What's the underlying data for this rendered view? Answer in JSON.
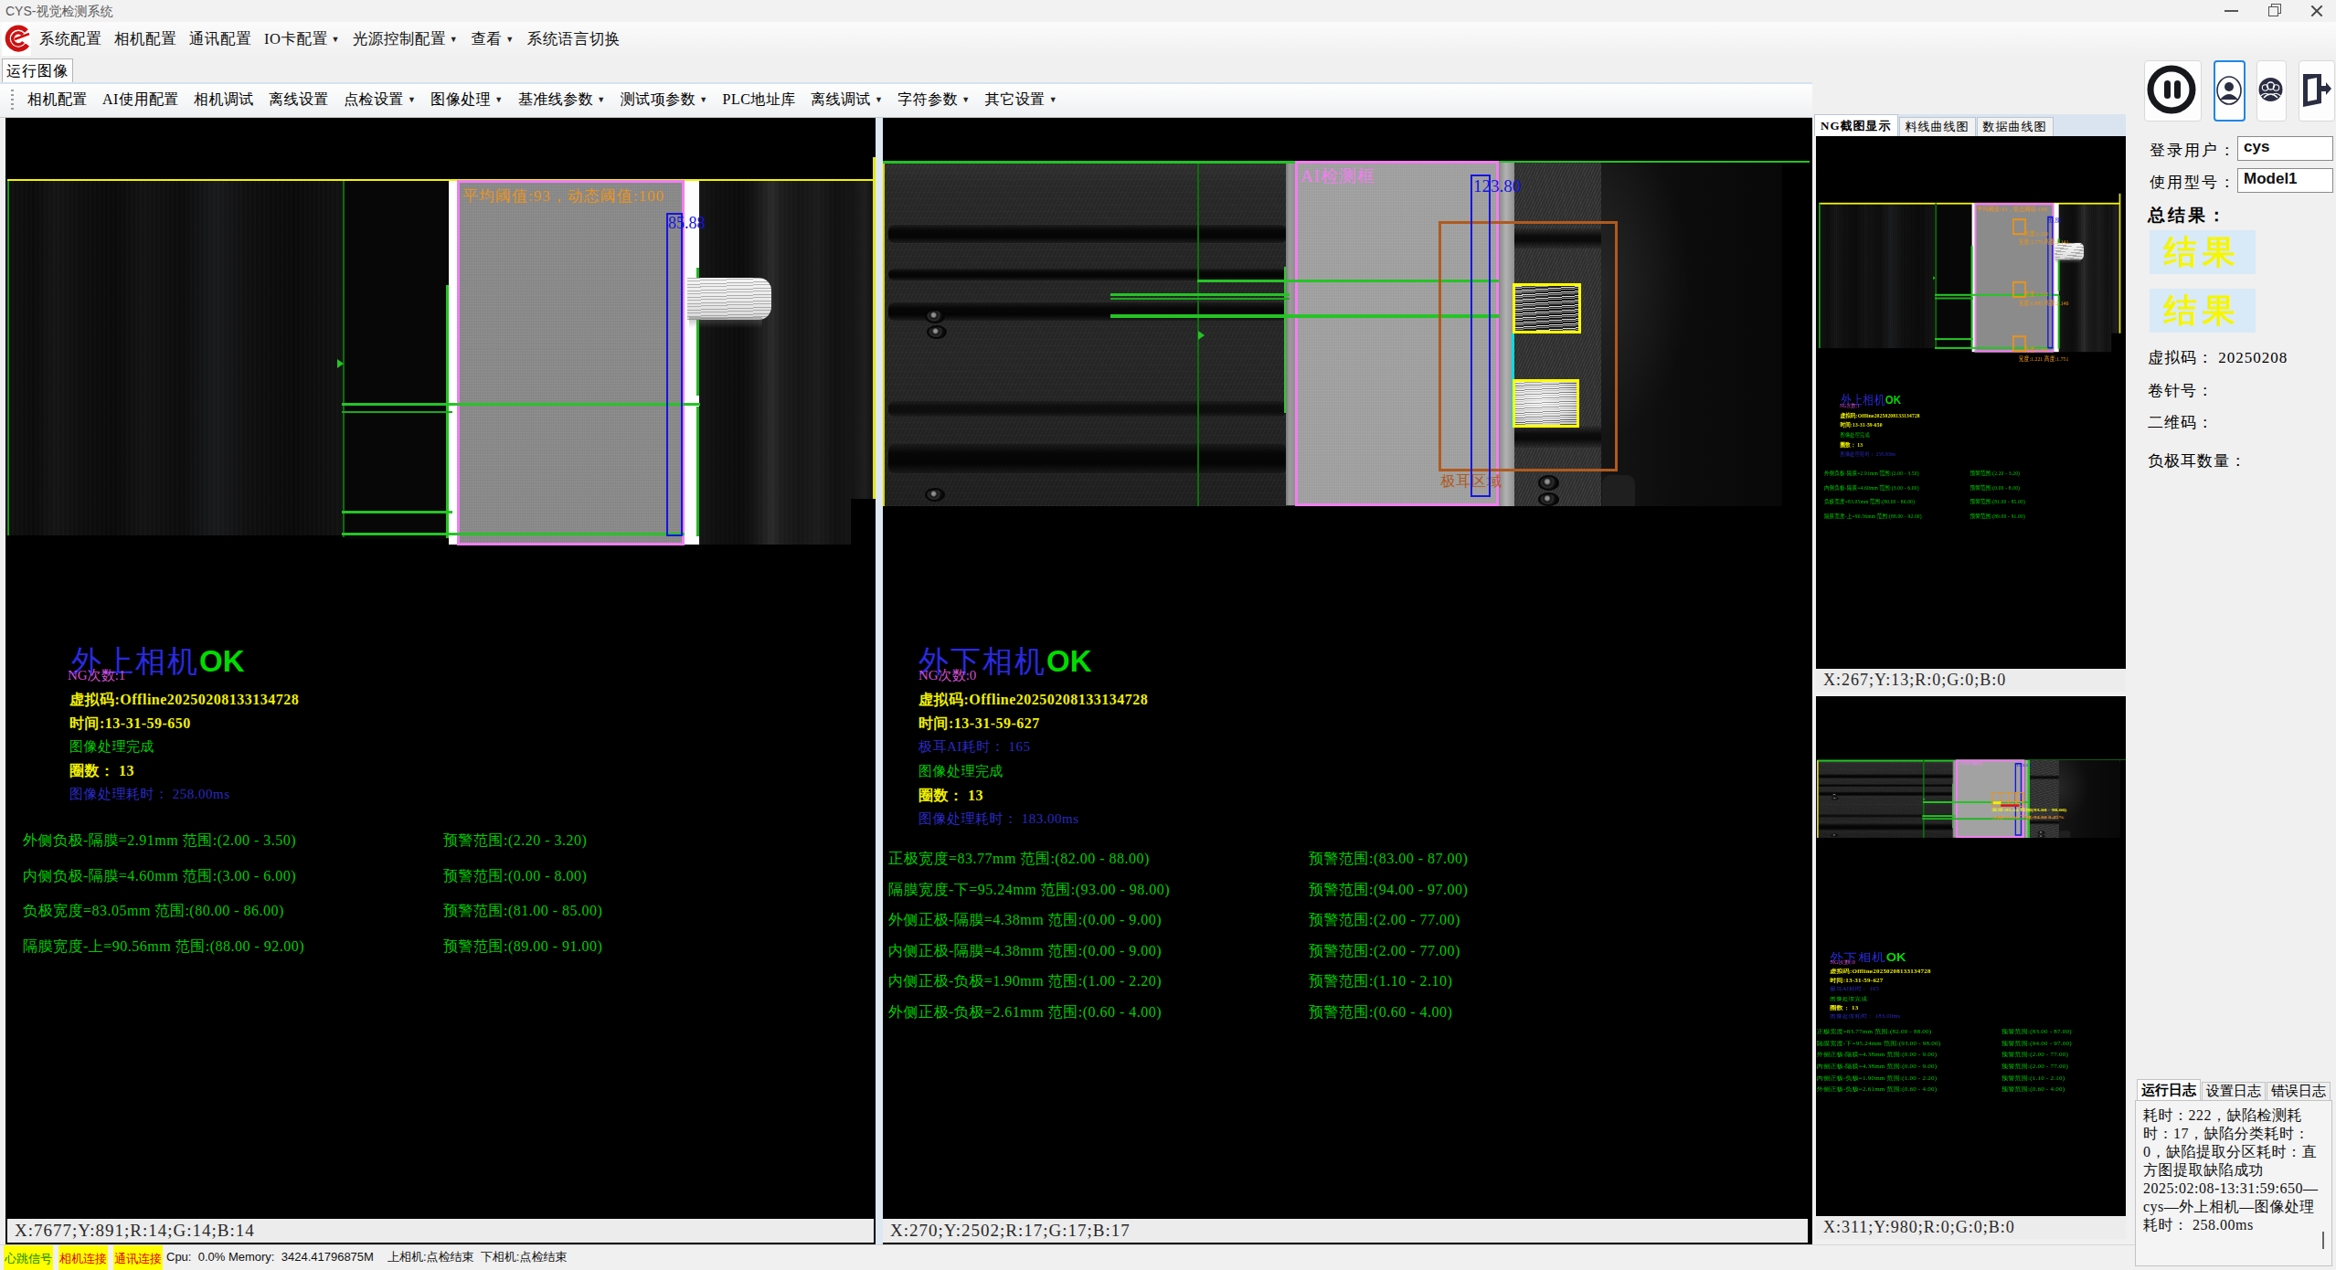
{
  "window": {
    "title": "CYS-视觉检测系统",
    "controls": {
      "minimize": "minimize",
      "maximize": "maximize",
      "close": "✕"
    }
  },
  "menu": {
    "items": [
      {
        "label": "系统配置",
        "arrow": false
      },
      {
        "label": "相机配置",
        "arrow": false
      },
      {
        "label": "通讯配置",
        "arrow": false
      },
      {
        "label": "IO卡配置",
        "arrow": true
      },
      {
        "label": "光源控制配置",
        "arrow": true
      },
      {
        "label": "查看",
        "arrow": true
      },
      {
        "label": "系统语言切换",
        "arrow": false
      }
    ]
  },
  "tab": {
    "label": "运行图像"
  },
  "toolbar": {
    "items": [
      {
        "label": "相机配置",
        "arrow": false
      },
      {
        "label": "AI使用配置",
        "arrow": false
      },
      {
        "label": "相机调试",
        "arrow": false
      },
      {
        "label": "离线设置",
        "arrow": false
      },
      {
        "label": "点检设置",
        "arrow": true
      },
      {
        "label": "图像处理",
        "arrow": true
      },
      {
        "label": "基准线参数",
        "arrow": true
      },
      {
        "label": "测试项参数",
        "arrow": true
      },
      {
        "label": "PLC地址库",
        "arrow": false
      },
      {
        "label": "离线调试",
        "arrow": true
      },
      {
        "label": "字符参数",
        "arrow": true
      },
      {
        "label": "其它设置",
        "arrow": true
      }
    ]
  },
  "left_camera": {
    "threshold_text": "平均阈值:93，动态阈值:100",
    "width_value": "85.88",
    "title": "外上相机",
    "ok": "OK",
    "ng_text": "NG次数:1",
    "vcode": "虚拟码:Offline20250208133134728",
    "time": "时间:13-31-59-650",
    "done": "图像处理完成",
    "loops": "圈数： 13",
    "elapsed": "图像处理耗时： 258.00ms",
    "measurements": [
      {
        "main": "外侧负极-隔膜=2.91mm 范围:(2.00 - 3.50)",
        "warn": "预警范围:(2.20 - 3.20)"
      },
      {
        "main": "内侧负极-隔膜=4.60mm 范围:(3.00 - 6.00)",
        "warn": "预警范围:(0.00 - 8.00)"
      },
      {
        "main": "负极宽度=83.05mm 范围:(80.00 - 86.00)",
        "warn": "预警范围:(81.00 - 85.00)"
      },
      {
        "main": "隔膜宽度-上=90.56mm 范围:(88.00 - 92.00)",
        "warn": "预警范围:(89.00 - 91.00)"
      }
    ],
    "coord": "X:7677;Y:891;R:14;G:14;B:14"
  },
  "right_camera": {
    "ai_box_label": "AI检测框",
    "tab_region_label": "极耳区域",
    "width_value": "123.80",
    "title": "外下相机",
    "ok": "OK",
    "ng_text": "NG次数:0",
    "vcode": "虚拟码:Offline20250208133134728",
    "time": "时间:13-31-59-627",
    "ai_time": "极耳AI耗时： 165",
    "done": "图像处理完成",
    "loops": "圈数： 13",
    "elapsed": "图像处理耗时： 183.00ms",
    "measurements": [
      {
        "main": "正极宽度=83.77mm 范围:(82.00 - 88.00)",
        "warn": "预警范围:(83.00 - 87.00)"
      },
      {
        "main": "隔膜宽度-下=95.24mm 范围:(93.00 - 98.00)",
        "warn": "预警范围:(94.00 - 97.00)"
      },
      {
        "main": "外侧正极-隔膜=4.38mm 范围:(0.00 - 9.00)",
        "warn": "预警范围:(2.00 - 77.00)"
      },
      {
        "main": "内侧正极-隔膜=4.38mm 范围:(0.00 - 9.00)",
        "warn": "预警范围:(2.00 - 77.00)"
      },
      {
        "main": "内侧正极-负极=1.90mm 范围:(1.00 - 2.20)",
        "warn": "预警范围:(1.10 - 2.10)"
      },
      {
        "main": "外侧正极-负极=2.61mm 范围:(0.60 - 4.00)",
        "warn": "预警范围:(0.60 - 4.00)"
      }
    ],
    "coord": "X:270;Y:2502;R:17;G:17;B:17"
  },
  "previews": {
    "tabs": [
      {
        "label": "NG截图显示",
        "active": true
      },
      {
        "label": "料线曲线图",
        "active": false
      },
      {
        "label": "数据曲线图",
        "active": false
      }
    ],
    "p1_coord": "X:267;Y:13;R:0;G:0;B:0",
    "p2_coord": "X:311;Y:980;R:0;G:0;B:0",
    "p1_marks": [
      {
        "l1": "亮度:1.226",
        "l2": "宽度:1.775 高度:1.141"
      },
      {
        "l1": "亮度:1.512",
        "l2": "宽度:0.885 高度:2.146"
      },
      {
        "l1": "亮度:1.301",
        "l2": "宽度:1.221 高度:1.751"
      }
    ],
    "p2_mark_lines": [
      {
        "text": "宽度:95.24 范围(93.00 - 98.00)",
        "color": "#f0f000"
      },
      {
        "text": "上限:97.00 下限:94.00 0.45%",
        "color": "#e8941a"
      }
    ]
  },
  "sidebar": {
    "login_label": "登录用户：",
    "login_value": "cys",
    "model_label": "使用型号：",
    "model_value": "Model1",
    "result_label": "总结果：",
    "result1": "结果",
    "result2": "结果",
    "vcode_line": "虚拟码： 20250208",
    "roll_line": "卷针号：",
    "qr_line": "二维码：",
    "tab_count_line": "负极耳数量："
  },
  "log": {
    "tabs": [
      {
        "label": "运行日志",
        "active": true
      },
      {
        "label": "设置日志",
        "active": false
      },
      {
        "label": "错误日志",
        "active": false
      }
    ],
    "lines": [
      "耗时：222，缺陷检测耗时：17，缺陷分类耗时：0，缺陷提取分区耗时：直方图提取缺陷成功",
      "2025:02:08-13:31:59:650—cys—外上相机—图像处理耗时： 258.00ms"
    ]
  },
  "status_bar": {
    "heartbeat": "心跳信号",
    "camera": "相机连接",
    "comm": "通讯连接",
    "cpu": "Cpu:  0.0% Memory:  3424.41796875M",
    "check": "上相机:点检结束  下相机:点检结束"
  }
}
